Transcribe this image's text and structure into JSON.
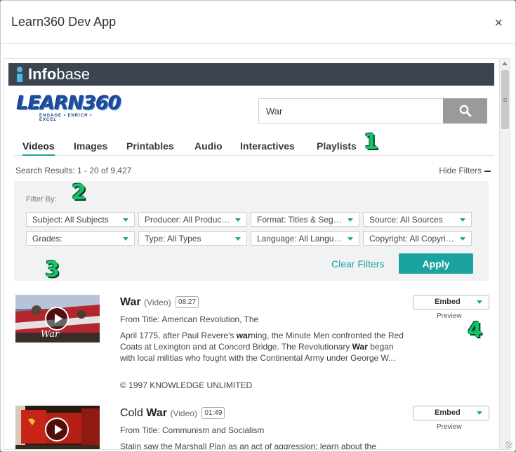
{
  "dialog": {
    "title": "Learn360 Dev App",
    "close_glyph": "×"
  },
  "infobase": {
    "brand_bold": "Info",
    "brand_light": "base"
  },
  "learn360": {
    "logo_text": "LEARN360",
    "tagline": "ENGAGE • ENRICH • EXCEL"
  },
  "search": {
    "value": "War",
    "icon": "search-icon"
  },
  "tabs": [
    {
      "label": "Videos",
      "active": true
    },
    {
      "label": "Images"
    },
    {
      "label": "Printables"
    },
    {
      "label": "Audio"
    },
    {
      "label": "Interactives"
    },
    {
      "label": "Playlists"
    }
  ],
  "annotations": [
    "1",
    "2",
    "3",
    "4"
  ],
  "results_summary": "Search Results: 1 - 20 of 9,427",
  "hide_filters": "Hide Filters",
  "filters": {
    "label": "Filter By:",
    "selects": [
      "Subject: All Subjects",
      "Producer: All Producers",
      "Format: Titles & Segments",
      "Source: All Sources",
      "Grades:",
      "Type: All Types",
      "Language: All Languages",
      "Copyright: All Copyrights"
    ],
    "clear_label": "Clear Filters",
    "apply_label": "Apply"
  },
  "results": [
    {
      "title_pre": "",
      "title_bold": "War",
      "kind": "(Video)",
      "duration": "08:27",
      "from": "From Title: American Revolution, The",
      "desc_1": "April 1775, after Paul Revere's ",
      "desc_b1": "war",
      "desc_2": "ning, the Minute Men confronted the Red Coats at Lexington and at Concord Bridge. The Revolutionary ",
      "desc_b2": "War",
      "desc_3": " began with local militias who fought with the Continental Army under George W...",
      "copyright": "© 1997 KNOWLEDGE UNLIMITED",
      "thumb_caption": "War",
      "embed_label": "Embed",
      "preview_label": "Preview"
    },
    {
      "title_pre": "Cold ",
      "title_bold": "War",
      "kind": "(Video)",
      "duration": "01:49",
      "from": "From Title: Communism and Socialism",
      "desc_1": "Stalin saw the Marshall Plan as an act of aggression; learn about the",
      "embed_label": "Embed",
      "preview_label": "Preview"
    }
  ],
  "colors": {
    "accent": "#1aa3a0",
    "infobar": "#3c4450",
    "badge": "#12c46a"
  }
}
